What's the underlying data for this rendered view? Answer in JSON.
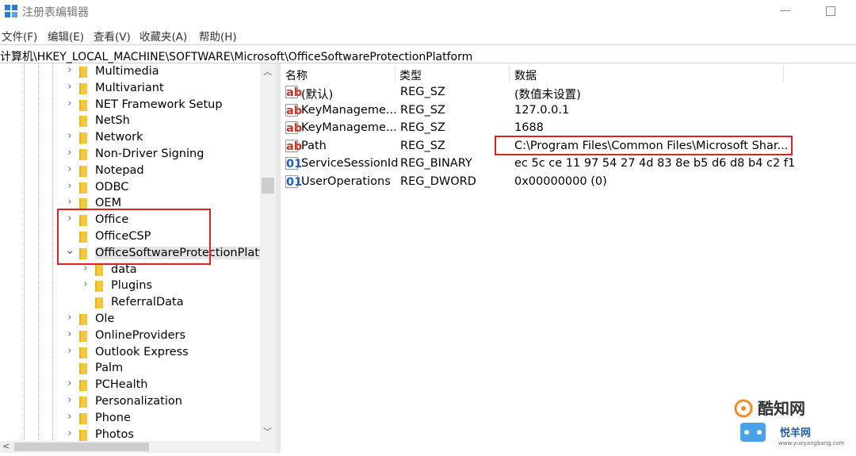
{
  "window": {
    "title": "注册表编辑器"
  },
  "menu": [
    "文件(F)",
    "编辑(E)",
    "查看(V)",
    "收藏夹(A)",
    "帮助(H)"
  ],
  "address": "计算机\\HKEY_LOCAL_MACHINE\\SOFTWARE\\Microsoft\\OfficeSoftwareProtectionPlatform",
  "tree": [
    {
      "label": "Multimedia",
      "level": 1,
      "expandable": true
    },
    {
      "label": "Multivariant",
      "level": 1,
      "expandable": true
    },
    {
      "label": "NET Framework Setup",
      "level": 1,
      "expandable": true
    },
    {
      "label": "NetSh",
      "level": 1,
      "expandable": false
    },
    {
      "label": "Network",
      "level": 1,
      "expandable": true
    },
    {
      "label": "Non-Driver Signing",
      "level": 1,
      "expandable": true
    },
    {
      "label": "Notepad",
      "level": 1,
      "expandable": true
    },
    {
      "label": "ODBC",
      "level": 1,
      "expandable": true
    },
    {
      "label": "OEM",
      "level": 1,
      "expandable": true
    },
    {
      "label": "Office",
      "level": 1,
      "expandable": true
    },
    {
      "label": "OfficeCSP",
      "level": 1,
      "expandable": false
    },
    {
      "label": "OfficeSoftwareProtectionPlatfo",
      "level": 1,
      "expandable": true,
      "expanded": true,
      "selected": true
    },
    {
      "label": "data",
      "level": 2,
      "expandable": true
    },
    {
      "label": "Plugins",
      "level": 2,
      "expandable": true
    },
    {
      "label": "ReferralData",
      "level": 2,
      "expandable": false
    },
    {
      "label": "Ole",
      "level": 1,
      "expandable": true
    },
    {
      "label": "OnlineProviders",
      "level": 1,
      "expandable": true
    },
    {
      "label": "Outlook Express",
      "level": 1,
      "expandable": true
    },
    {
      "label": "Palm",
      "level": 1,
      "expandable": false
    },
    {
      "label": "PCHealth",
      "level": 1,
      "expandable": true
    },
    {
      "label": "Personalization",
      "level": 1,
      "expandable": true
    },
    {
      "label": "Phone",
      "level": 1,
      "expandable": true
    },
    {
      "label": "Photos",
      "level": 1,
      "expandable": true
    }
  ],
  "columns": {
    "name": "名称",
    "type": "类型",
    "data": "数据"
  },
  "values": [
    {
      "icon": "string-value-icon",
      "name": "(默认)",
      "type": "REG_SZ",
      "data": "(数值未设置)"
    },
    {
      "icon": "string-value-icon",
      "name": "KeyManageme...",
      "type": "REG_SZ",
      "data": "127.0.0.1"
    },
    {
      "icon": "string-value-icon",
      "name": "KeyManageme...",
      "type": "REG_SZ",
      "data": "1688"
    },
    {
      "icon": "string-value-icon",
      "name": "Path",
      "type": "REG_SZ",
      "data": "C:\\Program Files\\Common Files\\Microsoft Shar..."
    },
    {
      "icon": "binary-value-icon",
      "name": "ServiceSessionId",
      "type": "REG_BINARY",
      "data": "ec 5c ce 11 97 54 27 4d 83 8e b5 d6 d8 b4 c2 f1"
    },
    {
      "icon": "binary-value-icon",
      "name": "UserOperations",
      "type": "REG_DWORD",
      "data": "0x00000000 (0)"
    }
  ],
  "watermark": {
    "line1": "酷知网",
    "line2": "悦羊网",
    "line3": "www.yueyangbang.com"
  },
  "colors": {
    "highlight_box": "#dd2222",
    "folder": "#f3c840",
    "selection": "#e5e5e5"
  }
}
